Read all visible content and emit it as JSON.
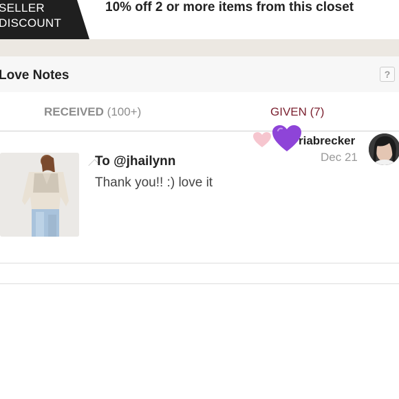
{
  "banner": {
    "badge_line1": "SELLER",
    "badge_line2": "DISCOUNT",
    "promo_text": "10% off 2 or more items from this closet"
  },
  "love_notes": {
    "title": "Love Notes",
    "help_label": "?",
    "tabs": {
      "received_label": "RECEIVED",
      "received_count": "(100+)",
      "given_label": "GIVEN (7)"
    },
    "note": {
      "to": "To @jhailynn",
      "message": "Thank you!! :) love it",
      "sender": "riabrecker",
      "date": "Dec 21"
    }
  },
  "colors": {
    "given_tab": "#7a1f2e",
    "badge_bg": "#1f1f1f",
    "heart_purple": "#8e44d8",
    "heart_pink": "#f6c6cf"
  },
  "icons": [
    "pink-heart-icon",
    "purple-heart-icon",
    "help-icon"
  ]
}
